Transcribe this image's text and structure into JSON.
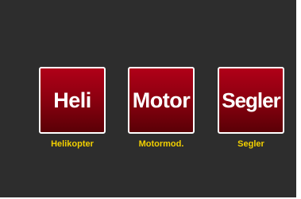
{
  "model_types": [
    {
      "tile_label": "Heli",
      "caption": "Helikopter"
    },
    {
      "tile_label": "Motor",
      "caption": "Motormod."
    },
    {
      "tile_label": "Segler",
      "caption": "Segler"
    }
  ],
  "colors": {
    "background": "#2d2d2d",
    "tile_red": "#8e0010",
    "tile_border": "#ffffff",
    "caption_yellow": "#f2d000"
  }
}
